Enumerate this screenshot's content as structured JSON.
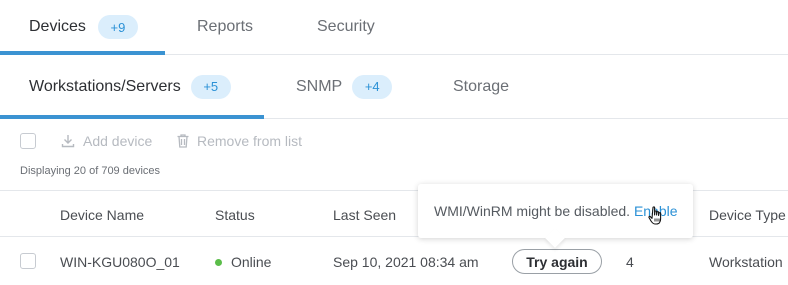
{
  "top_tabs": [
    {
      "label": "Devices",
      "badge": "+9",
      "active": true
    },
    {
      "label": "Reports",
      "active": false
    },
    {
      "label": "Security",
      "active": false
    }
  ],
  "sub_tabs": [
    {
      "label": "Workstations/Servers",
      "badge": "+5",
      "active": true
    },
    {
      "label": "SNMP",
      "badge": "+4",
      "active": false
    },
    {
      "label": "Storage",
      "active": false
    }
  ],
  "toolbar": {
    "add_device": "Add device",
    "remove_from_list": "Remove from list",
    "displaying": "Displaying 20 of 709 devices"
  },
  "table": {
    "columns": [
      "Device Name",
      "Status",
      "Last Seen",
      "Device Type"
    ],
    "rows": [
      {
        "device_name": "WIN-KGU080O_01",
        "status": "Online",
        "last_seen": "Sep 10, 2021 08:34 am",
        "action": "Try again",
        "count": "4",
        "device_type": "Workstation"
      }
    ]
  },
  "tooltip": {
    "message": "WMI/WinRM might be disabled.",
    "link": "Enable"
  },
  "colors": {
    "accent": "#3b93d2",
    "badge_bg": "#dbeefc",
    "badge_text": "#2b91d6",
    "online": "#5bbd4a"
  }
}
